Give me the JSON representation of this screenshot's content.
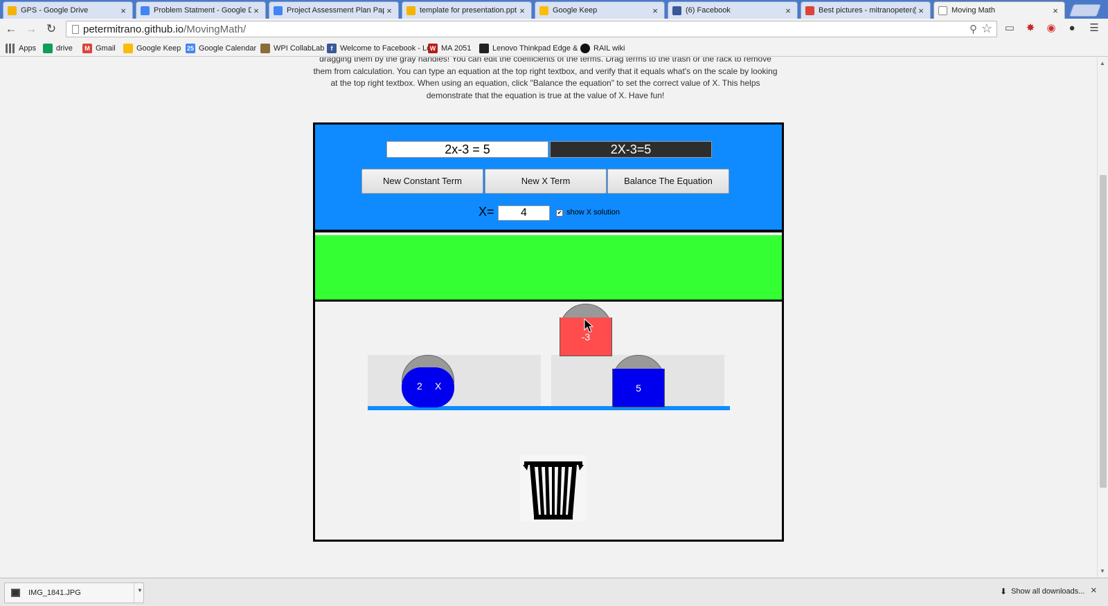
{
  "tabs": [
    {
      "label": "GPS - Google Drive",
      "favicon_color": "#f4b400"
    },
    {
      "label": "Problem Statment - Google D",
      "favicon_color": "#4285f4"
    },
    {
      "label": "Project Assessment Plan Pape",
      "favicon_color": "#4285f4"
    },
    {
      "label": "template for presentation.ppt",
      "favicon_color": "#f4b400"
    },
    {
      "label": "Google Keep",
      "favicon_color": "#fbbc05"
    },
    {
      "label": "(6) Facebook",
      "favicon_color": "#3b5998"
    },
    {
      "label": "Best pictures - mitranopeter@",
      "favicon_color": "#db4437"
    },
    {
      "label": "Moving Math",
      "favicon_color": "#ffffff"
    }
  ],
  "toolbar": {
    "url_host": "petermitrano.github.io",
    "url_path": "/MovingMath/"
  },
  "bookmarks": [
    {
      "label": "Apps",
      "icon_color": "#666666"
    },
    {
      "label": "drive",
      "icon_color": "#0f9d58"
    },
    {
      "label": "Gmail",
      "icon_color": "#db4437"
    },
    {
      "label": "Google Keep",
      "icon_color": "#fbbc05"
    },
    {
      "label": "Google Calendar",
      "icon_color": "#4285f4",
      "icon_text": "25"
    },
    {
      "label": "WPI CollabLab",
      "icon_color": "#8a6d3b"
    },
    {
      "label": "Welcome to Facebook - Lo",
      "icon_color": "#3b5998",
      "icon_text": "f"
    },
    {
      "label": "MA 2051",
      "icon_color": "#b71c1c",
      "icon_text": "W"
    },
    {
      "label": "Lenovo Thinkpad Edge &",
      "icon_color": "#222222"
    },
    {
      "label": "RAIL wiki",
      "icon_color": "#111111"
    }
  ],
  "page": {
    "instructions": [
      "dragging them by the gray handles! You can edit the coefficients of the terms. Drag terms to the trash or the rack to remove",
      "them from calculation. You can type an equation at the top right textbox, and verify that it equals what's on the scale by looking",
      "at the top right textbox. When using an equation, click \"Balance the equation\" to set the correct value of X. This helps",
      "demonstrate that the equation is true at the value of X. Have fun!"
    ]
  },
  "app": {
    "equation_input": "2x-3 = 5",
    "equation_display": "2X-3=5",
    "buttons": {
      "new_constant": "New Constant Term",
      "new_x": "New X Term",
      "balance": "Balance The Equation"
    },
    "x_label": "X=",
    "x_value": "4",
    "show_solution_label": "show X solution",
    "show_solution_checked": true,
    "terms": {
      "left_x_coef": "2",
      "left_x_var": "X",
      "right_const": "5",
      "floating_const": "-3"
    },
    "colors": {
      "top_panel": "#0f8bff",
      "rack": "#33ff33",
      "x_term": "#0000ee",
      "positive_const": "#0000ee",
      "negative_const": "#ff4d4d",
      "beam": "#0f8bff"
    }
  },
  "downloads": {
    "file": "IMG_1841.JPG",
    "show_all": "Show all downloads..."
  }
}
